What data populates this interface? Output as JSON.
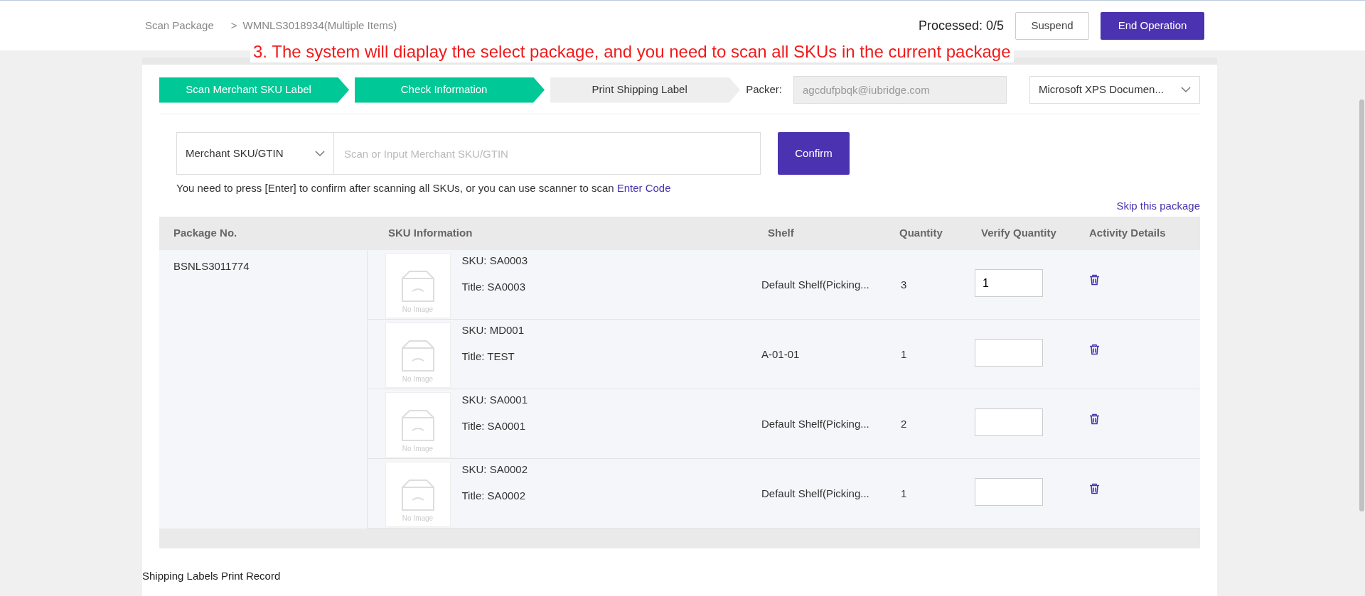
{
  "breadcrumb": {
    "root": "Scan Package",
    "separator": ">",
    "current": "WMNLS3018934(Multiple Items)"
  },
  "processed": "Processed: 0/5",
  "header_buttons": [
    {
      "label": "Suspend",
      "kind": "outline"
    },
    {
      "label": "End Operation",
      "kind": "primary"
    }
  ],
  "annotation": "3. The system will diaplay the select package, and you need to scan all SKUs in the current package",
  "steps": [
    {
      "label": "Scan Merchant SKU Label",
      "done": true
    },
    {
      "label": "Check Information",
      "done": true
    },
    {
      "label": "Print Shipping Label",
      "done": false
    }
  ],
  "packer": {
    "label": "Packer:",
    "value": "agcdufpbqk@iubridge.com",
    "disabled": true
  },
  "printer": {
    "value": "Microsoft XPS Documen..."
  },
  "scan": {
    "type": "Merchant SKU/GTIN",
    "placeholder": "Scan or Input Merchant SKU/GTIN",
    "button": "Confirm"
  },
  "hint": {
    "text": "You need to press [Enter] to confirm after scanning all SKUs, or you can use scanner to scan",
    "link": "Enter Code"
  },
  "skip_link": "Skip this package",
  "table": {
    "columns": [
      "Package No.",
      "SKU Information",
      "Shelf",
      "Quantity",
      "Verify Quantity",
      "Activity Details"
    ],
    "package_no": "BSNLS3011774",
    "rows": [
      {
        "image_text": "No Image",
        "sku": "SKU: SA0003",
        "title": "Title: SA0003",
        "shelf": "Default Shelf(Picking...",
        "quantity": "3",
        "verify": "1"
      },
      {
        "image_text": "No Image",
        "sku": "SKU: MD001",
        "title": "Title: TEST",
        "shelf": "A-01-01",
        "quantity": "1"
      },
      {
        "image_text": "No Image",
        "sku": "SKU: SA0001",
        "title": "Title: SA0001",
        "shelf": "Default Shelf(Picking...",
        "quantity": "2"
      },
      {
        "image_text": "No Image",
        "sku": "SKU: SA0002",
        "title": "Title: SA0002",
        "shelf": "Default Shelf(Picking...",
        "quantity": "1"
      }
    ]
  },
  "section_title": "Shipping Labels Print Record"
}
